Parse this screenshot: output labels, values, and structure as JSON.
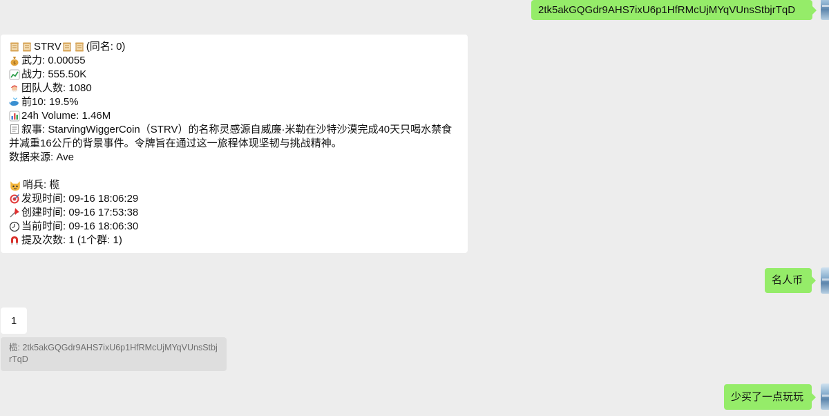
{
  "messages": {
    "sent_address": "2tk5akGQGdr9AHS7ixU6p1HfRMcUjMYqVUnsStbjrTqD",
    "card": {
      "title_token": "STRV",
      "title_suffix": "(同名: 0)",
      "wuli": "武力: 0.00055",
      "zhanli": "战力: 555.50K",
      "team": "团队人数: 1080",
      "top10": "前10: 19.5%",
      "volume": "24h Volume: 1.46M",
      "narrative": "叙事: StarvingWiggerCoin（STRV）的名称灵感源自威廉·米勒在沙特沙漠完成40天只喝水禁食并减重16公斤的背景事件。令牌旨在通过这一旅程体现坚韧与挑战精神。",
      "source": "数据来源: Ave",
      "sentinel": "哨兵: 榄",
      "found_time": "发现时间: 09-16 18:06:29",
      "created_time": "创建时间: 09-16 17:53:38",
      "current_time": "当前时间: 09-16 18:06:30",
      "mentions": "提及次数: 1 (1个群: 1)"
    },
    "sent_celebrity": "名人币",
    "received_one": "1",
    "quote": "榄: 2tk5akGQGdr9AHS7ixU6p1HfRMcUjMYqVUnsStbjrTqD",
    "sent_buy": "少买了一点玩玩"
  },
  "icons": {
    "scroll": "scroll-icon",
    "money_bag": "money-bag-icon",
    "chart_up": "chart-increasing-icon",
    "santa": "santa-face-icon",
    "whale": "spouting-whale-icon",
    "bar_chart": "bar-chart-icon",
    "memo": "memo-icon",
    "cat": "cat-face-icon",
    "target": "direct-hit-icon",
    "pushpin": "pushpin-icon",
    "clock": "clock-icon",
    "magnet": "magnet-icon"
  },
  "colors": {
    "background": "#ededed",
    "sent_bubble": "#95ec69",
    "received_bubble": "#ffffff",
    "quote_bubble": "#dedede",
    "quote_text": "#6f6f6f"
  }
}
